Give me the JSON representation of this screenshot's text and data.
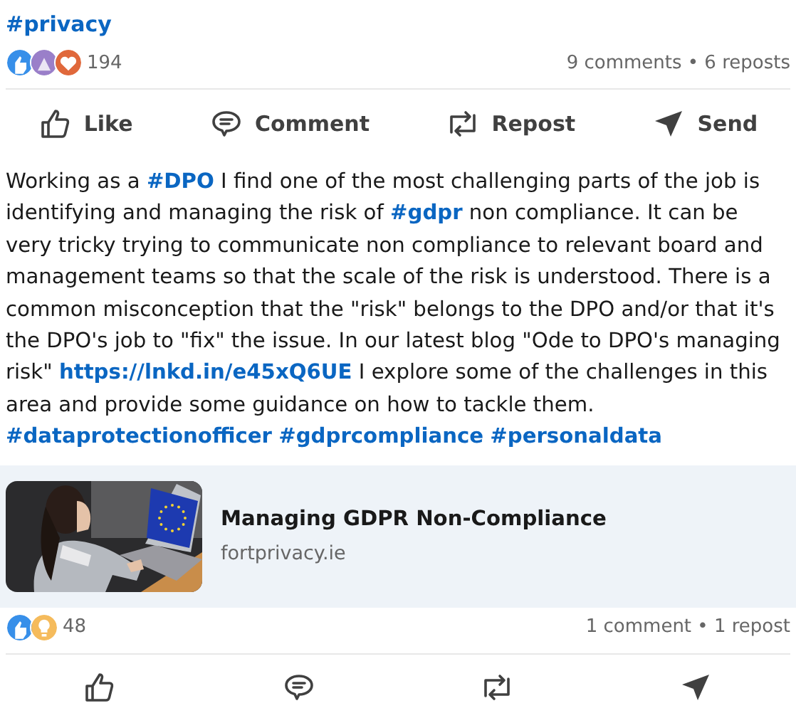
{
  "top_hashtag": "#privacy",
  "post": {
    "reactions": [
      {
        "kind": "like"
      },
      {
        "kind": "celebrate"
      },
      {
        "kind": "love"
      }
    ],
    "reaction_count": "194",
    "stats": "9 comments • 6 reposts",
    "actions": [
      {
        "kind": "like",
        "label": "Like"
      },
      {
        "kind": "comment",
        "label": "Comment"
      },
      {
        "kind": "repost",
        "label": "Repost"
      },
      {
        "kind": "send",
        "label": "Send"
      }
    ]
  },
  "body": [
    {
      "kind": "text",
      "text": "Working as a "
    },
    {
      "kind": "hashtag",
      "text": "#DPO"
    },
    {
      "kind": "text",
      "text": " I find one of the most challenging parts of the job is identifying and managing the risk of "
    },
    {
      "kind": "hashtag",
      "text": "#gdpr"
    },
    {
      "kind": "text",
      "text": " non compliance. It can be very tricky trying to communicate non compliance to relevant board and management teams so that the scale of the risk is understood. There is a common misconception that the \"risk\" belongs to the DPO and/or that it's the DPO's job to \"fix\" the issue. In our latest blog \"Ode to DPO's managing risk\" "
    },
    {
      "kind": "link",
      "text": "https://lnkd.in/e45xQ6UE"
    },
    {
      "kind": "text",
      "text": " I explore some of the challenges in this area and provide some guidance on how to tackle them. "
    },
    {
      "kind": "hashtag",
      "text": "#dataprotectionofficer"
    },
    {
      "kind": "hashtag",
      "text": "#gdprcompliance"
    },
    {
      "kind": "hashtag",
      "text": "#personaldata"
    }
  ],
  "link_card": {
    "title": "Managing GDPR Non-Compliance",
    "domain": "fortprivacy.ie"
  },
  "shared_post": {
    "reactions": [
      {
        "kind": "like"
      },
      {
        "kind": "insight"
      }
    ],
    "reaction_count": "48",
    "stats": "1 comment • 1 repost",
    "actions": [
      {
        "kind": "like"
      },
      {
        "kind": "comment"
      },
      {
        "kind": "repost"
      },
      {
        "kind": "send"
      }
    ]
  }
}
